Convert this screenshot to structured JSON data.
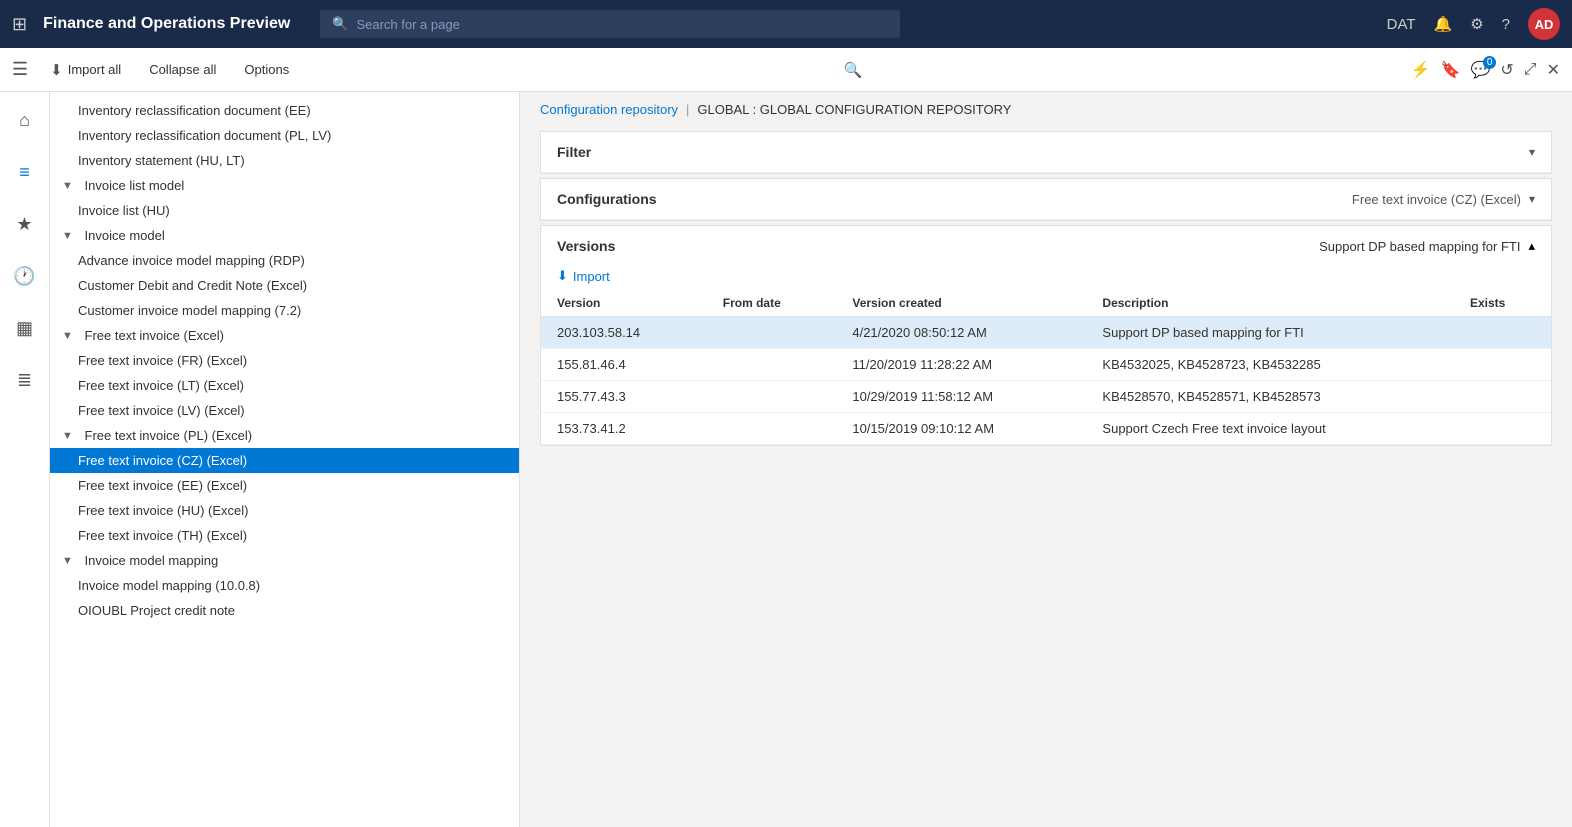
{
  "appTitle": "Finance and Operations Preview",
  "searchPlaceholder": "Search for a page",
  "topNav": {
    "datLabel": "DAT",
    "userInitials": "AD"
  },
  "toolbar": {
    "importAll": "Import all",
    "collapseAll": "Collapse all",
    "options": "Options"
  },
  "breadcrumb": {
    "repo": "Configuration repository",
    "separator": "|",
    "current": "GLOBAL : GLOBAL CONFIGURATION REPOSITORY"
  },
  "filterCard": {
    "title": "Filter"
  },
  "configurationsCard": {
    "title": "Configurations",
    "selectedConfig": "Free text invoice (CZ) (Excel)"
  },
  "versionsCard": {
    "title": "Versions",
    "subtitle": "Support DP based mapping for FTI",
    "importBtn": "Import",
    "columns": [
      "Version",
      "From date",
      "Version created",
      "Description",
      "Exists"
    ],
    "rows": [
      {
        "version": "203.103.58.14",
        "fromDate": "",
        "versionCreated": "4/21/2020 08:50:12 AM",
        "description": "Support DP based mapping for FTI",
        "exists": "",
        "selected": true
      },
      {
        "version": "155.81.46.4",
        "fromDate": "",
        "versionCreated": "11/20/2019 11:28:22 AM",
        "description": "KB4532025, KB4528723, KB4532285",
        "exists": "",
        "selected": false
      },
      {
        "version": "155.77.43.3",
        "fromDate": "",
        "versionCreated": "10/29/2019 11:58:12 AM",
        "description": "KB4528570, KB4528571, KB4528573",
        "exists": "",
        "selected": false
      },
      {
        "version": "153.73.41.2",
        "fromDate": "",
        "versionCreated": "10/15/2019 09:10:12 AM",
        "description": "Support Czech Free text invoice layout",
        "exists": "",
        "selected": false
      }
    ]
  },
  "treeItems": [
    {
      "label": "Inventory reclassification document (EE)",
      "level": 1,
      "type": "leaf"
    },
    {
      "label": "Inventory reclassification document (PL, LV)",
      "level": 1,
      "type": "leaf"
    },
    {
      "label": "Inventory statement (HU, LT)",
      "level": 1,
      "type": "leaf"
    },
    {
      "label": "Invoice list model",
      "level": 0,
      "type": "group",
      "collapsed": false
    },
    {
      "label": "Invoice list (HU)",
      "level": 1,
      "type": "leaf"
    },
    {
      "label": "Invoice model",
      "level": 0,
      "type": "group",
      "collapsed": false
    },
    {
      "label": "Advance invoice model mapping (RDP)",
      "level": 1,
      "type": "leaf"
    },
    {
      "label": "Customer Debit and Credit Note (Excel)",
      "level": 1,
      "type": "leaf"
    },
    {
      "label": "Customer invoice model mapping (7.2)",
      "level": 1,
      "type": "leaf"
    },
    {
      "label": "Free text invoice (Excel)",
      "level": 0,
      "type": "group",
      "collapsed": false
    },
    {
      "label": "Free text invoice (FR) (Excel)",
      "level": 1,
      "type": "leaf"
    },
    {
      "label": "Free text invoice (LT) (Excel)",
      "level": 1,
      "type": "leaf"
    },
    {
      "label": "Free text invoice (LV) (Excel)",
      "level": 1,
      "type": "leaf"
    },
    {
      "label": "Free text invoice (PL) (Excel)",
      "level": 0,
      "type": "group",
      "collapsed": false
    },
    {
      "label": "Free text invoice (CZ) (Excel)",
      "level": 1,
      "type": "leaf",
      "selected": true
    },
    {
      "label": "Free text invoice (EE) (Excel)",
      "level": 1,
      "type": "leaf"
    },
    {
      "label": "Free text invoice (HU) (Excel)",
      "level": 1,
      "type": "leaf"
    },
    {
      "label": "Free text invoice (TH) (Excel)",
      "level": 1,
      "type": "leaf"
    },
    {
      "label": "Invoice model mapping",
      "level": 0,
      "type": "group",
      "collapsed": false
    },
    {
      "label": "Invoice model mapping (10.0.8)",
      "level": 1,
      "type": "leaf"
    },
    {
      "label": "OIOUBL Project credit note",
      "level": 1,
      "type": "leaf"
    }
  ]
}
